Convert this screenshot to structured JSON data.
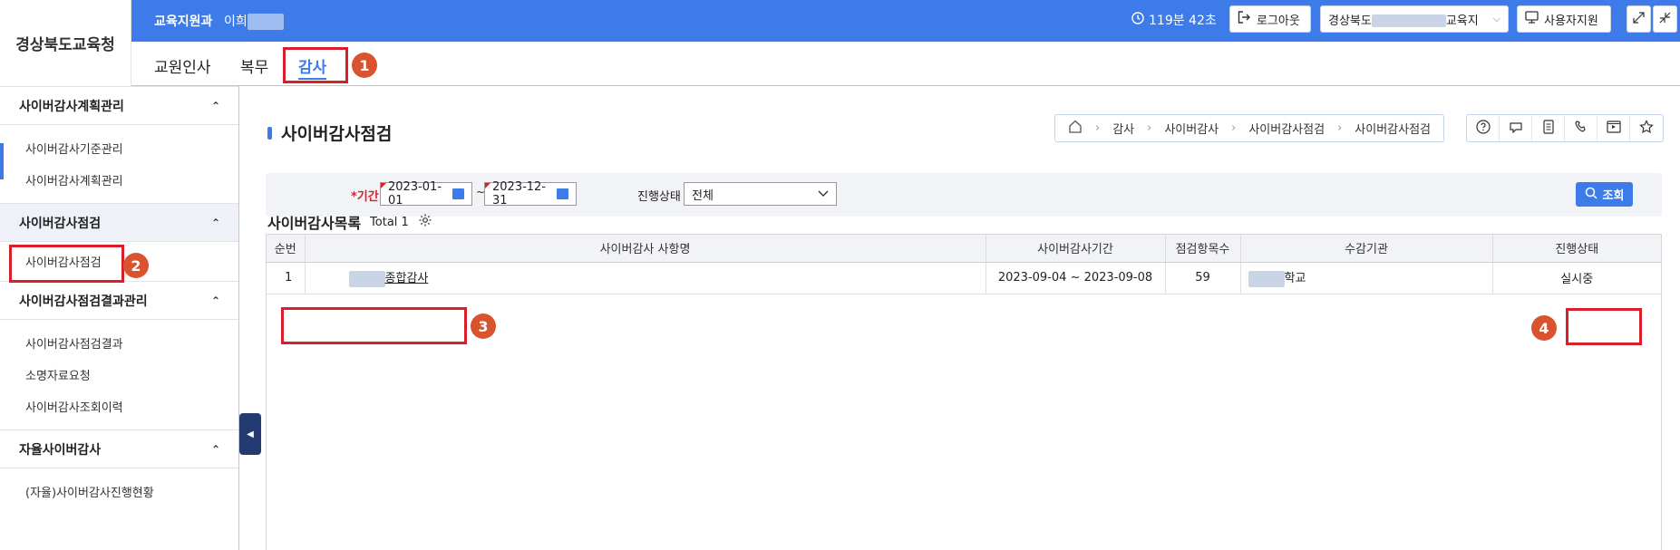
{
  "header": {
    "logo": "경상북도교육청",
    "department": "교육지원과",
    "user_name_visible": "이희",
    "timer": "119분 42초",
    "logout_label": "로그아웃",
    "org_select_prefix": "경상북도",
    "org_select_suffix": "교육지",
    "support_label": "사용자지원"
  },
  "topnav": {
    "tabs": [
      {
        "label": "교원인사"
      },
      {
        "label": "복무"
      },
      {
        "label": "감사"
      }
    ]
  },
  "annotations": {
    "badge1": "1",
    "badge2": "2",
    "badge3": "3",
    "badge4": "4"
  },
  "sidebar": {
    "groups": [
      {
        "label": "사이버감사계획관리",
        "items": [
          "사이버감사기준관리",
          "사이버감사계획관리"
        ]
      },
      {
        "label": "사이버감사점검",
        "items": [
          "사이버감사점검"
        ]
      },
      {
        "label": "사이버감사점검결과관리",
        "items": [
          "사이버감사점검결과",
          "소명자료요청",
          "사이버감사조회이력"
        ]
      },
      {
        "label": "자율사이버감사",
        "items": [
          "(자율)사이버감사진행현황"
        ]
      }
    ]
  },
  "page": {
    "title": "사이버감사점검",
    "breadcrumb": [
      "감사",
      "사이버감사",
      "사이버감사점검",
      "사이버감사점검"
    ]
  },
  "search": {
    "period_label": "*기간",
    "start_date": "2023-01-01",
    "end_date": "2023-12-31",
    "tilde": "~",
    "status_label": "진행상태",
    "status_value": "전체",
    "search_button": "조회"
  },
  "list": {
    "title": "사이버감사목록",
    "total": "Total 1",
    "columns": [
      "순번",
      "사이버감사 사항명",
      "사이버감사기간",
      "점검항목수",
      "수감기관",
      "진행상태"
    ],
    "rows": [
      {
        "no": "1",
        "name": "종합감사",
        "period": "2023-09-04 ~ 2023-09-08",
        "items": "59",
        "org": "학교",
        "status": "실시중"
      }
    ]
  },
  "colors": {
    "accent": "#3d7be8",
    "highlight": "#d9202a",
    "badge": "#d9532f"
  }
}
